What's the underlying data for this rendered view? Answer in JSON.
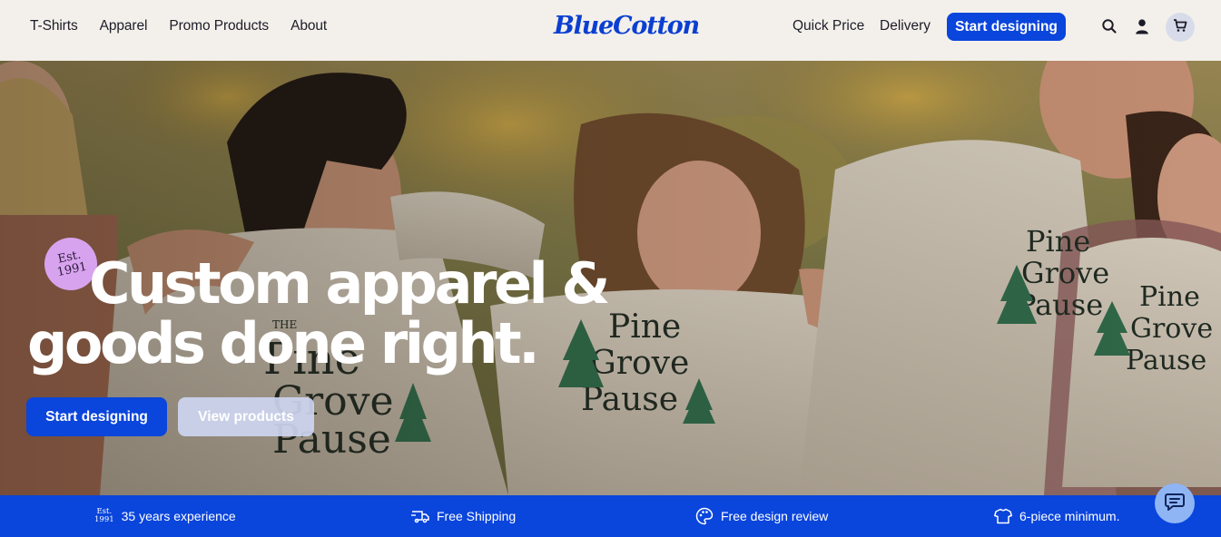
{
  "header": {
    "nav_left": [
      "T-Shirts",
      "Apparel",
      "Promo Products",
      "About"
    ],
    "logo": "BlueCotton",
    "quick_price": "Quick Price",
    "delivery": "Delivery",
    "cta": "Start designing",
    "icons": [
      "search-icon",
      "account-icon",
      "cart-icon"
    ]
  },
  "hero": {
    "badge_line1": "Est.",
    "badge_line2": "1991",
    "headline_line1": "Custom apparel &",
    "headline_line2": "goods done right.",
    "primary_cta": "Start designing",
    "secondary_cta": "View products",
    "shirt_text": [
      "THE",
      "Pine",
      "Grove",
      "Pause"
    ]
  },
  "features": [
    {
      "icon": "est-1991-icon",
      "label": "35 years experience",
      "icon_text_1": "Est.",
      "icon_text_2": "1991"
    },
    {
      "icon": "truck-icon",
      "label": "Free Shipping"
    },
    {
      "icon": "palette-icon",
      "label": "Free design review"
    },
    {
      "icon": "tshirt-icon",
      "label": "6-piece minimum."
    }
  ],
  "colors": {
    "brand_blue": "#0a45dc",
    "badge_purple": "#d8a3ee",
    "header_bg": "#f3f0eb",
    "chat_bubble": "#8fb5f5"
  }
}
